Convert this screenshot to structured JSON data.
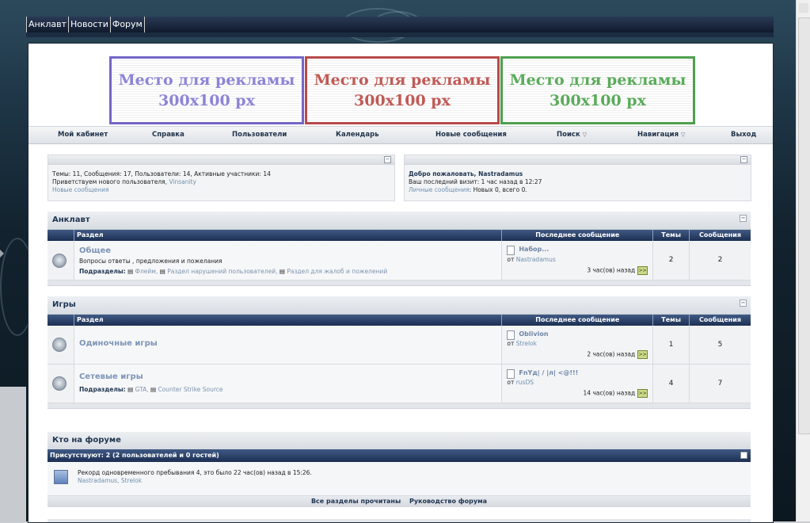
{
  "topnav": {
    "items": [
      "Анклавт",
      "Новости",
      "Форум"
    ]
  },
  "ads": [
    {
      "line1": "Место для рекламы",
      "line2": "300x100 px"
    },
    {
      "line1": "Место для рекламы",
      "line2": "300x100 px"
    },
    {
      "line1": "Место для рекламы",
      "line2": "300x100 px"
    }
  ],
  "navbar": {
    "cabinet": "Мой кабинет",
    "help": "Справка",
    "users": "Пользователи",
    "calendar": "Календарь",
    "new_posts": "Новые сообщения",
    "search": "Поиск",
    "navigation": "Навигация",
    "logout": "Выход"
  },
  "stats": {
    "line1": "Темы: 11, Сообщения: 17, Пользователи: 14, Активные участники: 14",
    "welcome_prefix": "Приветствуем нового пользователя, ",
    "new_user": "Vinsanity",
    "new_posts_link": "Новые сообщения"
  },
  "welcome": {
    "title": "Добро пожаловать, Nastradamus",
    "last_visit": "Ваш последний визит: 1 час назад в 12:27",
    "pm_link": "Личные сообщения",
    "pm_text": ": Новых 0, всего 0."
  },
  "table_headers": {
    "section": "Раздел",
    "last_post": "Последнее сообщение",
    "topics": "Темы",
    "posts": "Сообщения"
  },
  "categories": [
    {
      "title": "Анклавт",
      "forums": [
        {
          "name": "Общее",
          "description": "Вопросы ответы , предложения и пожелания",
          "subforums_label": "Подразделы:",
          "subforums": [
            "Флейм,",
            "Раздел нарушений пользователей,",
            "Раздел для жалоб и пожелений"
          ],
          "last_title": "Набор...",
          "last_by_prefix": "от ",
          "last_by": "Nastradamus",
          "last_time": "3 час(ов) назад",
          "topics": "2",
          "posts": "2"
        }
      ]
    },
    {
      "title": "Игры",
      "forums": [
        {
          "name": "Одиночные игры",
          "description": "",
          "subforums_label": "",
          "subforums": [],
          "last_title": "Oblivion",
          "last_by_prefix": "от ",
          "last_by": "Strelok",
          "last_time": "2 час(ов) назад",
          "topics": "1",
          "posts": "5"
        },
        {
          "name": "Сетевые игры",
          "description": "",
          "subforums_label": "Подразделы:",
          "subforums": [
            "GTA,",
            "Counter Strike Source"
          ],
          "last_title": "FnYд| / |л| <@!!!",
          "last_by_prefix": "от ",
          "last_by": "rusDS",
          "last_time": "14 час(ов) назад",
          "topics": "4",
          "posts": "7"
        }
      ]
    }
  ],
  "who": {
    "title": "Кто на форуме",
    "present": "Присутствуют: 2 (2 пользователей и 0 гостей)",
    "record": "Рекорд одновременного пребывания 4, это было 22 час(ов) назад в 15:26.",
    "users": "Nastradamus, Strelok",
    "footer_read": "Все разделы прочитаны",
    "footer_guide": "Руководство форума"
  },
  "icons": {
    "go": "go-arrow-icon",
    "collapse": "collapse-icon"
  }
}
